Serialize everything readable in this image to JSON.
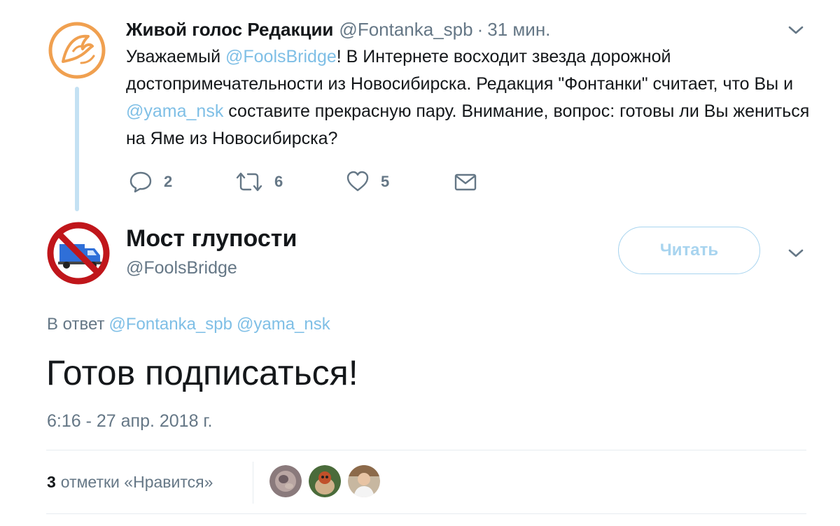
{
  "parent_tweet": {
    "author_name": "Живой голос Редакции",
    "author_handle": "@Fontanka_spb",
    "separator": "·",
    "time": "31 мин.",
    "text_parts": {
      "p1": "Уважаемый ",
      "m1": "@FoolsBridge",
      "p2": "! В Интернете восходит звезда дорожной достопримечательности из Новосибирска. Редакция \"Фонтанки\" считает, что Вы и ",
      "m2": "@yama_nsk",
      "p3": " составите прекрасную пару. Внимание, вопрос: готовы ли Вы жениться на Яме из Новосибирска?"
    },
    "actions": {
      "reply_count": "2",
      "retweet_count": "6",
      "like_count": "5"
    },
    "avatar_color": "#f0a050"
  },
  "tweet": {
    "author_name": "Мост глупости",
    "author_handle": "@FoolsBridge",
    "follow_label": "Читать",
    "reply_prefix": "В ответ",
    "reply_mentions": [
      "@Fontanka_spb",
      "@yama_nsk"
    ],
    "text": "Готов подписаться!",
    "timestamp": "6:16 - 27 апр. 2018 г.",
    "likes_count": "3",
    "likes_label": "отметки «Нравится»",
    "avatar_icon": "no-truck-sign-icon"
  },
  "colors": {
    "accent": "#1da1f2",
    "mention": "#7fbfe6",
    "secondary_text": "#657786",
    "thread_line": "#c4e1f3",
    "prohibition_red": "#c0161b"
  }
}
